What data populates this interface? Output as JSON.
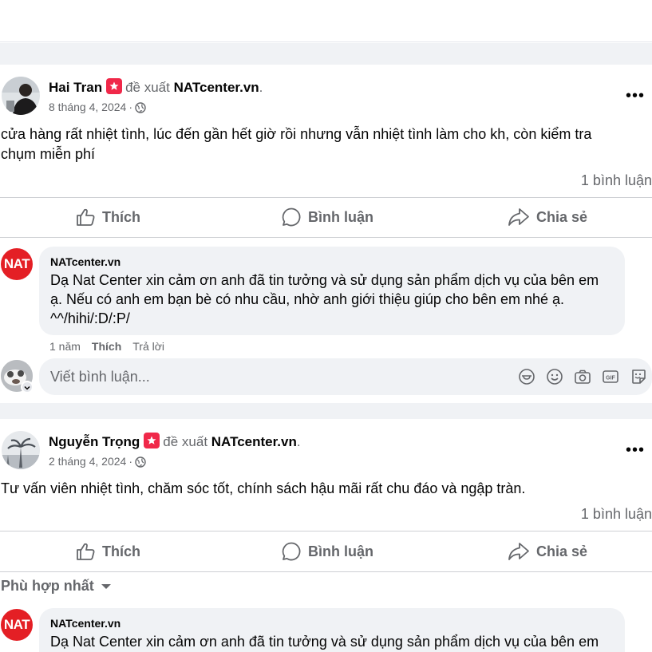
{
  "posts": [
    {
      "author": "Hai Tran",
      "recommend_word": "đề xuất",
      "target": "NATcenter.vn",
      "date": "8 tháng 4, 2024",
      "text": "cửa hàng rất nhiệt tình, lúc đến gần hết giờ rồi nhưng vẫn nhiệt tình làm cho kh, còn kiểm tra chụm miễn phí",
      "comment_count": "1 bình luận",
      "actions": {
        "like": "Thích",
        "comment": "Bình luận",
        "share": "Chia sẻ"
      },
      "reply": {
        "author": "NATcenter.vn",
        "avatar_text": "NAT",
        "text": "Dạ Nat Center xin cảm ơn anh đã tin tưởng và sử dụng sản phẩm dịch vụ của bên em ạ. Nếu có anh em bạn bè có nhu cầu, nhờ anh giới thiệu giúp cho bên em nhé ạ. ^^/hihi/:D/:P/",
        "time": "1 năm",
        "like": "Thích",
        "reply": "Trả lời"
      },
      "write_placeholder": "Viết bình luận..."
    },
    {
      "author": "Nguyễn Trọng",
      "recommend_word": "đề xuất",
      "target": "NATcenter.vn",
      "date": "2 tháng 4, 2024",
      "text": "Tư vấn viên nhiệt tình, chăm sóc tốt, chính sách hậu mãi rất chu đáo và ngập tràn.",
      "comment_count": "1 bình luận",
      "actions": {
        "like": "Thích",
        "comment": "Bình luận",
        "share": "Chia sẻ"
      },
      "sort_label": "Phù hợp nhất",
      "reply": {
        "author": "NATcenter.vn",
        "avatar_text": "NAT",
        "text": "Dạ Nat Center xin cảm ơn anh đã tin tưởng và sử dụng sản phẩm dịch vụ của bên em"
      }
    }
  ],
  "icons": {
    "recommend": "recommend-icon",
    "globe": "globe-icon",
    "more": "more-options-icon",
    "like": "thumbs-up-icon",
    "comment": "comment-bubble-icon",
    "share": "share-arrow-icon",
    "sticker": "avatar-sticker-icon",
    "emoji": "emoji-icon",
    "camera": "camera-icon",
    "gif": "gif-icon",
    "sticker2": "sticker-icon",
    "sort_caret": "caret-down-icon"
  },
  "colors": {
    "accent_red": "#e41f25",
    "recommend_badge": "#f02849",
    "secondary_text": "#65676b",
    "divider": "#ced0d4",
    "bubble_bg": "#f0f2f5"
  }
}
